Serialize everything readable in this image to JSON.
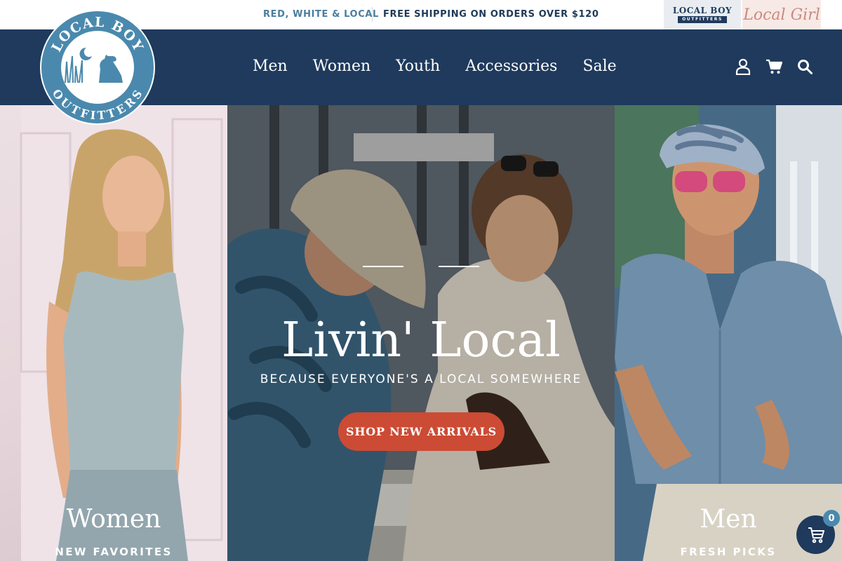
{
  "announcement": {
    "left_message": "RED, WHITE & LOCAL",
    "right_message": "FREE SHIPPING ON ORDERS OVER $120"
  },
  "brand_switcher": {
    "local_boy": {
      "line1": "LOCAL BOY",
      "line2": "OUTFITTERS"
    },
    "local_girl": {
      "label": "Local Girl"
    }
  },
  "logo": {
    "top_text": "LOCAL BOY",
    "bottom_text": "OUTFITTERS"
  },
  "nav": {
    "items": [
      {
        "label": "Men"
      },
      {
        "label": "Women"
      },
      {
        "label": "Youth"
      },
      {
        "label": "Accessories"
      },
      {
        "label": "Sale"
      }
    ],
    "icons": [
      "account-icon",
      "cart-icon",
      "search-icon"
    ]
  },
  "hero": {
    "left": {
      "title": "Women",
      "subtitle": "NEW FAVORITES"
    },
    "center": {
      "title": "Livin' Local",
      "subtitle": "BECAUSE EVERYONE'S A LOCAL SOMEWHERE",
      "cta": "SHOP NEW ARRIVALS"
    },
    "right": {
      "title": "Men",
      "subtitle": "FRESH PICKS"
    }
  },
  "cart": {
    "count": "0"
  },
  "colors": {
    "navy": "#1f3a5c",
    "brand_blue": "#4a89ad",
    "cta_red": "#cc4b34",
    "announcement_blue": "#4a7e9e"
  }
}
